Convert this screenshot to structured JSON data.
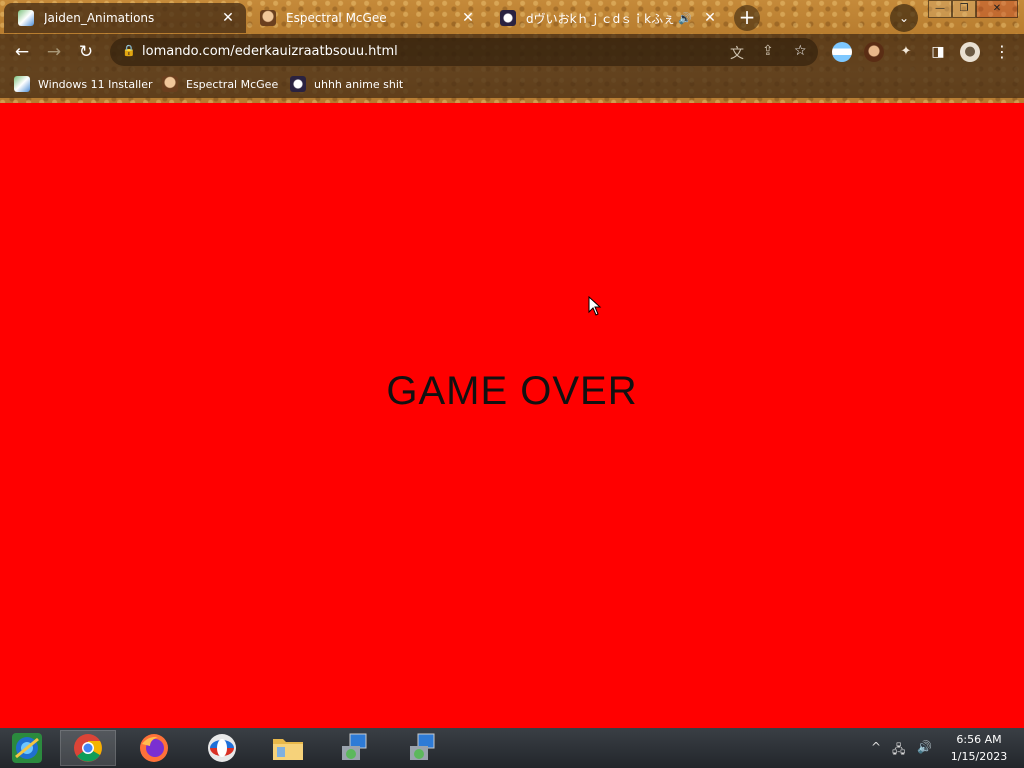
{
  "tabs": [
    {
      "title": "Jaiden_Animations",
      "active": true,
      "close": "✕"
    },
    {
      "title": "Espectral McGee",
      "active": false,
      "close": "✕"
    },
    {
      "title": "dヴいおkｈｊｃdｓｉkふぇ",
      "active": false,
      "close": "✕",
      "audio": "🔊"
    }
  ],
  "new_tab_label": "+",
  "tab_search_icon": "⌄",
  "window_controls": {
    "minimize": "—",
    "maximize": "❐",
    "close": "✕"
  },
  "nav": {
    "back": "←",
    "forward": "→",
    "reload": "↻"
  },
  "address_bar": {
    "url": "lomando.com/ederkauizraatbsouu.html",
    "lock_icon": "🔒",
    "translate_icon": "文",
    "share_icon": "⇪",
    "star_icon": "☆"
  },
  "extensions": {
    "profile_icon": "●",
    "menu": "⋮"
  },
  "bookmarks": [
    {
      "label": "Windows 11 Installer"
    },
    {
      "label": "Espectral McGee"
    },
    {
      "label": "uhhh anime shit"
    }
  ],
  "page": {
    "headline": "GAME OVER",
    "background_color": "#ff0000"
  },
  "taskbar": {
    "items": [
      "start-orb",
      "chrome",
      "firefox",
      "opera",
      "file-explorer",
      "installer",
      "installer"
    ],
    "tray_arrow": "^",
    "time": "6:56 AM",
    "date": "1/15/2023"
  }
}
